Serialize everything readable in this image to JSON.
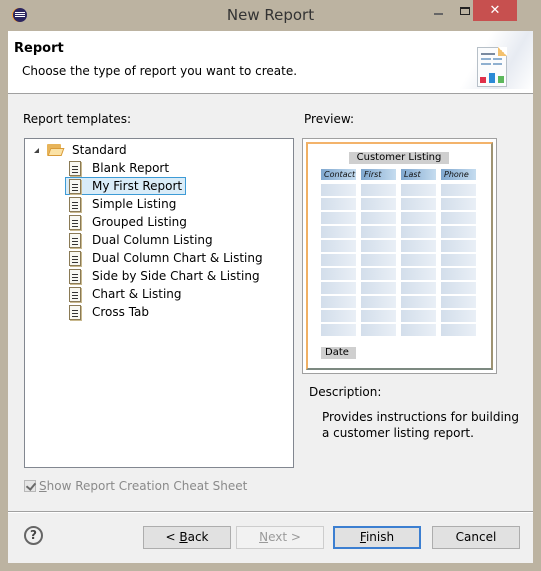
{
  "window": {
    "title": "New Report",
    "minimize_icon": "minimize-icon",
    "maximize_icon": "maximize-icon",
    "close_label": "✕"
  },
  "header": {
    "title": "Report",
    "description": "Choose the type of report you want to create.",
    "icon": "report-wizard-icon"
  },
  "templates": {
    "label": "Report templates:",
    "root": {
      "label": "Standard",
      "icon": "folder-open-icon",
      "expanded": true
    },
    "items": [
      {
        "label": "Blank Report",
        "selected": false
      },
      {
        "label": "My First Report",
        "selected": true
      },
      {
        "label": "Simple Listing",
        "selected": false
      },
      {
        "label": "Grouped Listing",
        "selected": false
      },
      {
        "label": "Dual Column Listing",
        "selected": false
      },
      {
        "label": "Dual Column Chart & Listing",
        "selected": false
      },
      {
        "label": "Side by Side Chart & Listing",
        "selected": false
      },
      {
        "label": "Chart & Listing",
        "selected": false
      },
      {
        "label": "Cross Tab",
        "selected": false
      }
    ]
  },
  "preview": {
    "label": "Preview:",
    "title": "Customer Listing",
    "columns": [
      "Contact",
      "First",
      "Last",
      "Phone"
    ],
    "row_count": 11,
    "footer": "Date"
  },
  "description": {
    "label": "Description:",
    "text": "Provides instructions for building a customer listing report."
  },
  "cheat_sheet": {
    "label_prefix": "",
    "mnemonic": "S",
    "label_rest": "how Report Creation Cheat Sheet",
    "checked": true,
    "enabled": false
  },
  "buttons": {
    "back": {
      "prefix": "< ",
      "mnemonic": "B",
      "rest": "ack",
      "enabled": true
    },
    "next": {
      "prefix": "",
      "mnemonic": "N",
      "rest": "ext >",
      "enabled": false
    },
    "finish": {
      "prefix": "",
      "mnemonic": "F",
      "rest": "inish",
      "enabled": true,
      "default": true
    },
    "cancel": {
      "label": "Cancel",
      "enabled": true
    }
  },
  "help_icon": "?",
  "colors": {
    "titlebar": "#bcb3a1",
    "close_button": "#c7504f",
    "selection_fill": "#d9ecf8",
    "selection_border": "#3d9bd6",
    "default_button_border": "#3c7fd1"
  }
}
